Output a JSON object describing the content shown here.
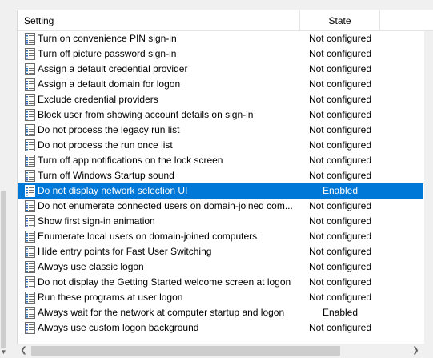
{
  "columns": {
    "setting": "Setting",
    "state": "State"
  },
  "rows": [
    {
      "name": "Turn on convenience PIN sign-in",
      "state": "Not configured"
    },
    {
      "name": "Turn off picture password sign-in",
      "state": "Not configured"
    },
    {
      "name": "Assign a default credential provider",
      "state": "Not configured"
    },
    {
      "name": "Assign a default domain for logon",
      "state": "Not configured"
    },
    {
      "name": "Exclude credential providers",
      "state": "Not configured"
    },
    {
      "name": "Block user from showing account details on sign-in",
      "state": "Not configured"
    },
    {
      "name": "Do not process the legacy run list",
      "state": "Not configured"
    },
    {
      "name": "Do not process the run once list",
      "state": "Not configured"
    },
    {
      "name": "Turn off app notifications on the lock screen",
      "state": "Not configured"
    },
    {
      "name": "Turn off Windows Startup sound",
      "state": "Not configured"
    },
    {
      "name": "Do not display network selection UI",
      "state": "Enabled",
      "selected": true
    },
    {
      "name": "Do not enumerate connected users on domain-joined com...",
      "state": "Not configured"
    },
    {
      "name": "Show first sign-in animation",
      "state": "Not configured"
    },
    {
      "name": "Enumerate local users on domain-joined computers",
      "state": "Not configured"
    },
    {
      "name": "Hide entry points for Fast User Switching",
      "state": "Not configured"
    },
    {
      "name": "Always use classic logon",
      "state": "Not configured"
    },
    {
      "name": "Do not display the Getting Started welcome screen at logon",
      "state": "Not configured"
    },
    {
      "name": "Run these programs at user logon",
      "state": "Not configured"
    },
    {
      "name": "Always wait for the network at computer startup and logon",
      "state": "Enabled"
    },
    {
      "name": "Always use custom logon background",
      "state": "Not configured"
    }
  ],
  "icons": {
    "row": "policy-setting-icon",
    "scroll_left": "scroll-left-arrow-icon",
    "scroll_right": "scroll-right-arrow-icon"
  },
  "colors": {
    "selection": "#0078d7",
    "icon_blue": "#2c6fb7",
    "scrollbar_thumb": "#cdcdcd"
  }
}
